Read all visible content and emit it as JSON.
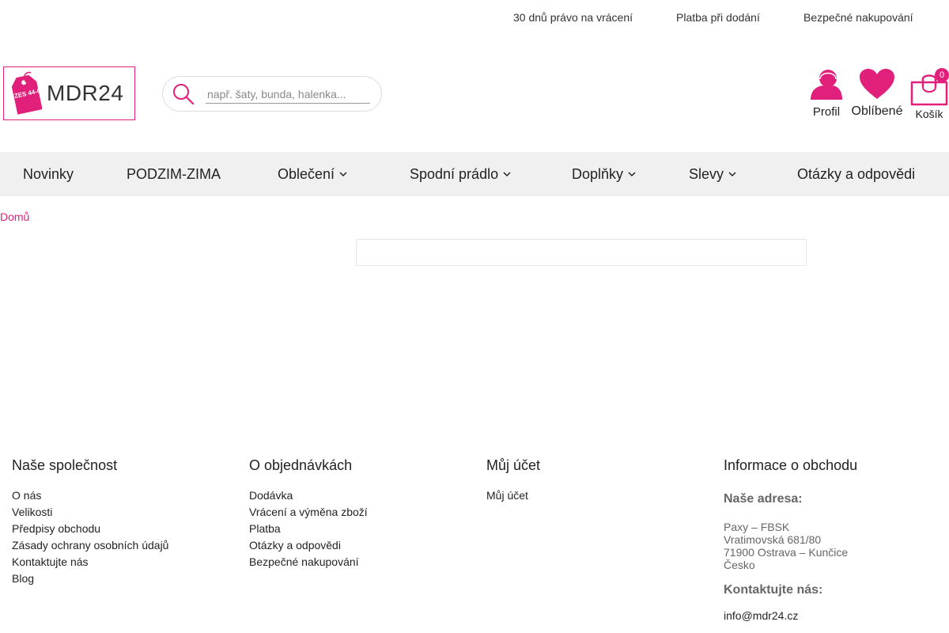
{
  "topbar": {
    "return_policy": "30 dnů právo na vrácení",
    "cod": "Platba při dodání",
    "secure": "Bezpečné nakupování"
  },
  "logo": {
    "text": "MDR24",
    "tag_text": "SIZES 44-64"
  },
  "search": {
    "placeholder": "např. šaty, bunda, halenka..."
  },
  "header_actions": {
    "profile": "Profil",
    "favorites": "Oblíbené",
    "cart": "Košík",
    "cart_count": "0"
  },
  "nav": {
    "items": [
      {
        "label": "Novinky"
      },
      {
        "label": "PODZIM-ZIMA"
      },
      {
        "label": "Oblečení"
      },
      {
        "label": "Spodní prádlo"
      },
      {
        "label": "Doplňky"
      },
      {
        "label": "Slevy"
      },
      {
        "label": "Otázky a odpovědi"
      }
    ]
  },
  "breadcrumb": {
    "home": "Domů"
  },
  "footer": {
    "company": {
      "title": "Naše společnost",
      "links": [
        "O nás",
        "Velikosti",
        "Předpisy obchodu",
        "Zásady ochrany osobních údajů",
        "Kontaktujte nás",
        "Blog"
      ]
    },
    "orders": {
      "title": "O objednávkách",
      "links": [
        "Dodávka",
        "Vrácení a výměna zboží",
        "Platba",
        "Otázky a odpovědi",
        "Bezpečné nakupování"
      ]
    },
    "account": {
      "title": "Můj účet",
      "links": [
        "Můj účet"
      ]
    },
    "store": {
      "title": "Informace o obchodu",
      "address_label": "Naše adresa:",
      "address_lines": [
        "Paxy – FBSK",
        "Vratimovská 681/80",
        "71900 Ostrava – Kunčice",
        "Česko"
      ],
      "contact_label": "Kontaktujte nás:",
      "email": "info@mdr24.cz"
    }
  },
  "colors": {
    "accent": "#e0207a",
    "nav_bg": "#f0f0f0",
    "muted_text": "#666666"
  }
}
